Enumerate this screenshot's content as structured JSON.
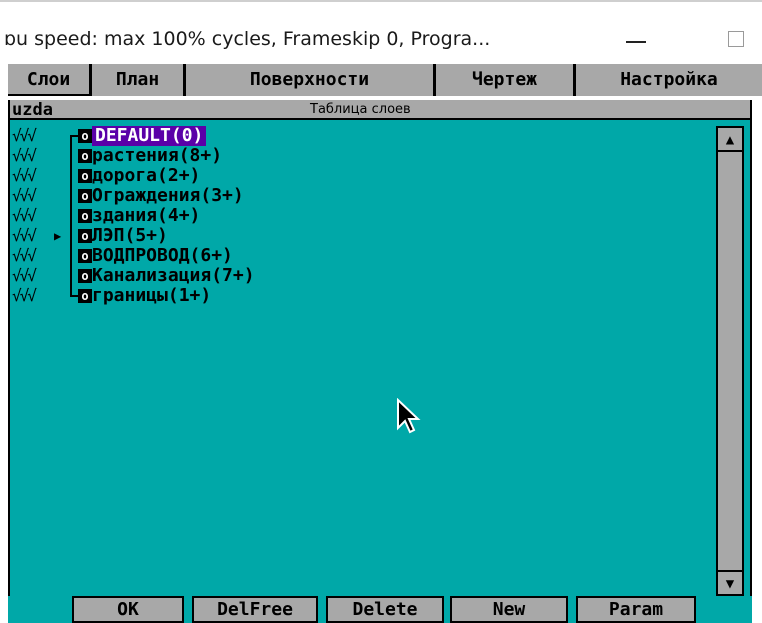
{
  "window": {
    "title": "ɒu speed: max 100% cycles, Frameskip  0, Progra..."
  },
  "menu": {
    "items": [
      "Слои",
      "План",
      "Поверхности",
      "Чертеж",
      "Настройка"
    ],
    "active": "Слои"
  },
  "panel": {
    "left_label": "uzda",
    "title": "Таблица слоев"
  },
  "layers": [
    {
      "flags": "√√√",
      "marker": "",
      "name": "DEFAULT(0)",
      "selected": true
    },
    {
      "flags": "√√√",
      "marker": "",
      "name": "растения(8+)",
      "selected": false
    },
    {
      "flags": "√√√",
      "marker": "",
      "name": "дорога(2+)",
      "selected": false
    },
    {
      "flags": "√√√",
      "marker": "",
      "name": "Ограждения(3+)",
      "selected": false
    },
    {
      "flags": "√√√",
      "marker": "",
      "name": "здания(4+)",
      "selected": false
    },
    {
      "flags": "√√√",
      "marker": "▶",
      "name": "ЛЭП(5+)",
      "selected": false
    },
    {
      "flags": "√√√",
      "marker": "",
      "name": "ВОДПРОВОД(6+)",
      "selected": false
    },
    {
      "flags": "√√√",
      "marker": "",
      "name": "Канализация(7+)",
      "selected": false
    },
    {
      "flags": "√√√",
      "marker": "",
      "name": "границы(1+)",
      "selected": false
    }
  ],
  "node_glyph": "o",
  "scrollbar": {
    "up_icon": "▲",
    "down_icon": "▼"
  },
  "buttons": {
    "ok": "OK",
    "delfree": "DelFree",
    "delete": "Delete",
    "new": "New",
    "param": "Param"
  },
  "colors": {
    "background": "#00a8a8",
    "menu_gray": "#a8a8a8",
    "selection": "#5a00a8"
  }
}
